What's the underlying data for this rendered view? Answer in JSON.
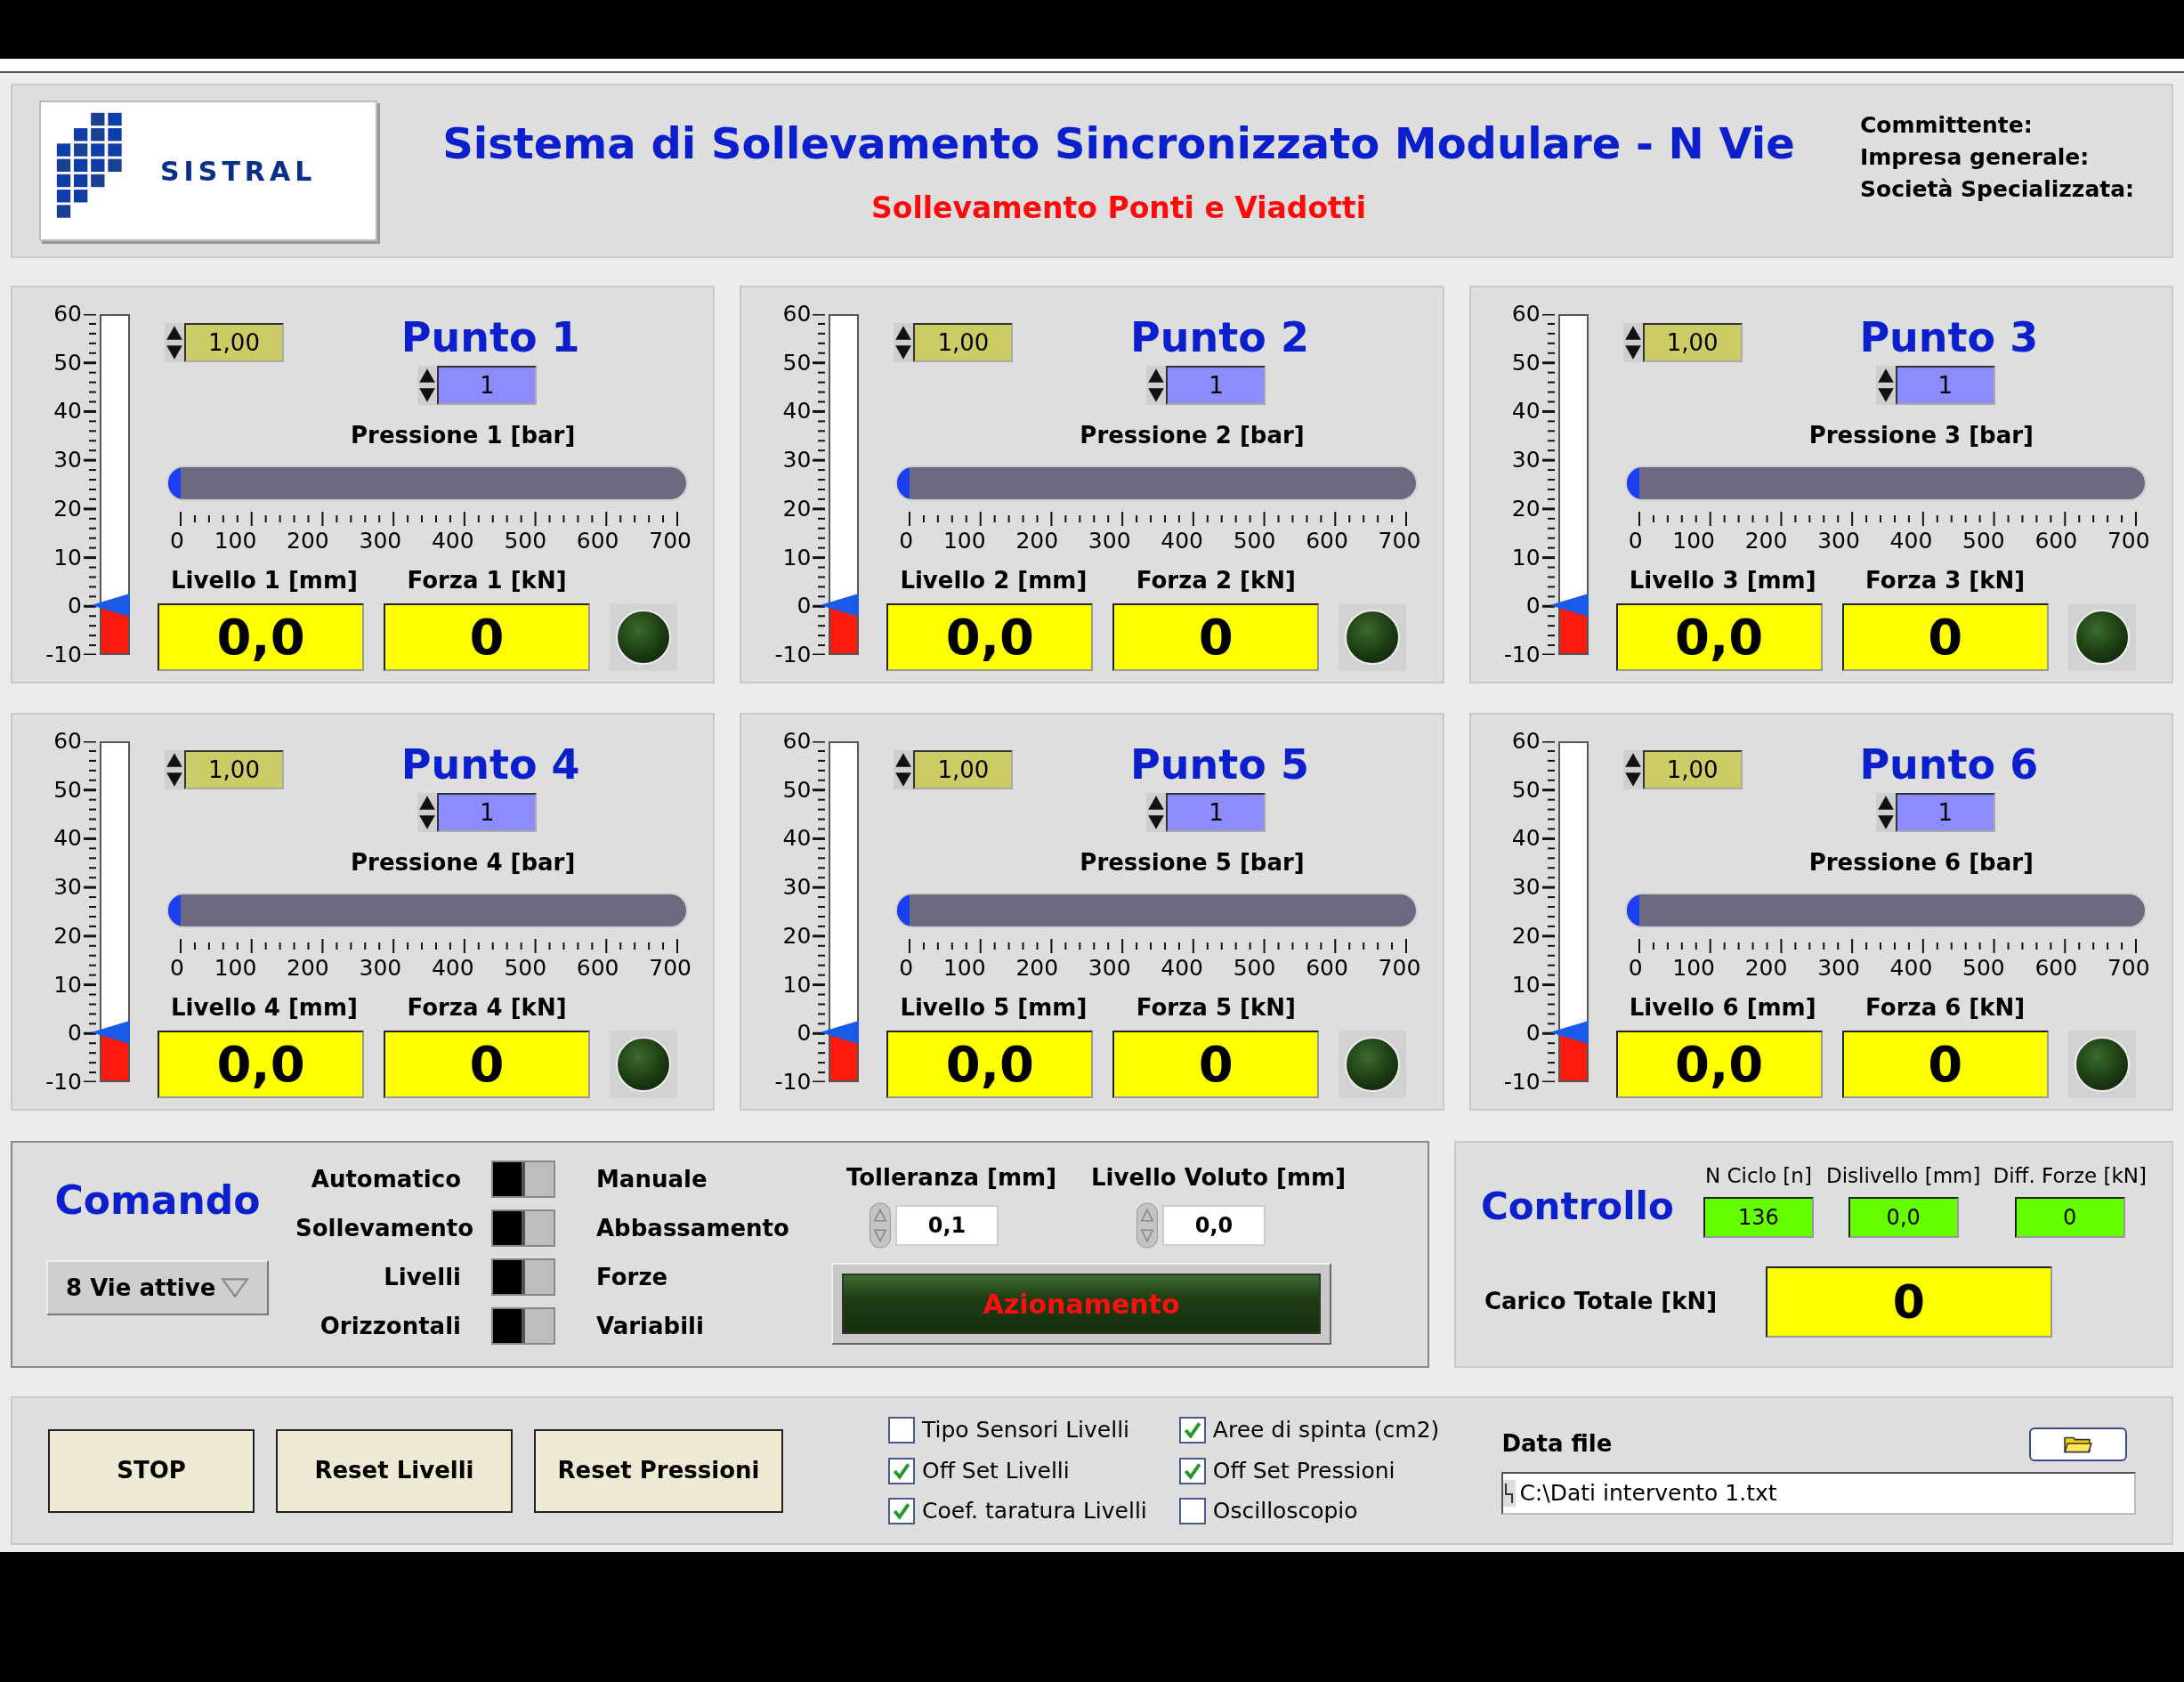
{
  "header": {
    "logo_text": "SISTRAL",
    "title": "Sistema di Sollevamento Sincronizzato Modulare - N Vie",
    "subtitle": "Sollevamento Ponti e Viadotti",
    "info": [
      "Committente:",
      "Impresa generale:",
      "Società Specializzata:"
    ]
  },
  "points": [
    {
      "title": "Punto 1",
      "gain": "1,00",
      "index": "1",
      "level_meter": {
        "level": 0.143,
        "scale": [
          "60",
          "50",
          "40",
          "30",
          "20",
          "10",
          "0",
          "-10"
        ]
      },
      "pressure_bar": {
        "label": "Pressione 1 [bar]",
        "level": 0,
        "scale": [
          "0",
          "100",
          "200",
          "300",
          "400",
          "500",
          "600",
          "700"
        ]
      },
      "level_label": "Livello 1 [mm]",
      "level_value": "0,0",
      "force_label": "Forza 1 [kN]",
      "force_value": "0",
      "led_on": false
    },
    {
      "title": "Punto 2",
      "gain": "1,00",
      "index": "1",
      "level_meter": {
        "level": 0.143,
        "scale": [
          "60",
          "50",
          "40",
          "30",
          "20",
          "10",
          "0",
          "-10"
        ]
      },
      "pressure_bar": {
        "label": "Pressione 2 [bar]",
        "level": 0,
        "scale": [
          "0",
          "100",
          "200",
          "300",
          "400",
          "500",
          "600",
          "700"
        ]
      },
      "level_label": "Livello 2 [mm]",
      "level_value": "0,0",
      "force_label": "Forza 2 [kN]",
      "force_value": "0",
      "led_on": false
    },
    {
      "title": "Punto 3",
      "gain": "1,00",
      "index": "1",
      "level_meter": {
        "level": 0.143,
        "scale": [
          "60",
          "50",
          "40",
          "30",
          "20",
          "10",
          "0",
          "-10"
        ]
      },
      "pressure_bar": {
        "label": "Pressione 3 [bar]",
        "level": 0,
        "scale": [
          "0",
          "100",
          "200",
          "300",
          "400",
          "500",
          "600",
          "700"
        ]
      },
      "level_label": "Livello 3 [mm]",
      "level_value": "0,0",
      "force_label": "Forza 3 [kN]",
      "force_value": "0",
      "led_on": false
    },
    {
      "title": "Punto 4",
      "gain": "1,00",
      "index": "1",
      "level_meter": {
        "level": 0.143,
        "scale": [
          "60",
          "50",
          "40",
          "30",
          "20",
          "10",
          "0",
          "-10"
        ]
      },
      "pressure_bar": {
        "label": "Pressione 4 [bar]",
        "level": 0,
        "scale": [
          "0",
          "100",
          "200",
          "300",
          "400",
          "500",
          "600",
          "700"
        ]
      },
      "level_label": "Livello 4 [mm]",
      "level_value": "0,0",
      "force_label": "Forza 4 [kN]",
      "force_value": "0",
      "led_on": false
    },
    {
      "title": "Punto 5",
      "gain": "1,00",
      "index": "1",
      "level_meter": {
        "level": 0.143,
        "scale": [
          "60",
          "50",
          "40",
          "30",
          "20",
          "10",
          "0",
          "-10"
        ]
      },
      "pressure_bar": {
        "label": "Pressione 5 [bar]",
        "level": 0,
        "scale": [
          "0",
          "100",
          "200",
          "300",
          "400",
          "500",
          "600",
          "700"
        ]
      },
      "level_label": "Livello 5 [mm]",
      "level_value": "0,0",
      "force_label": "Forza 5 [kN]",
      "force_value": "0",
      "led_on": false
    },
    {
      "title": "Punto 6",
      "gain": "1,00",
      "index": "1",
      "level_meter": {
        "level": 0.143,
        "scale": [
          "60",
          "50",
          "40",
          "30",
          "20",
          "10",
          "0",
          "-10"
        ]
      },
      "pressure_bar": {
        "label": "Pressione 6 [bar]",
        "level": 0,
        "scale": [
          "0",
          "100",
          "200",
          "300",
          "400",
          "500",
          "600",
          "700"
        ]
      },
      "level_label": "Livello 6 [mm]",
      "level_value": "0,0",
      "force_label": "Forza 6 [kN]",
      "force_value": "0",
      "led_on": false
    }
  ],
  "comando": {
    "title": "Comando",
    "mode_dropdown": "8 Vie attive",
    "switches": [
      {
        "left": "Automatico",
        "right": "Manuale",
        "toggled": false
      },
      {
        "left": "Sollevamento",
        "right": "Abbassamento",
        "toggled": false
      },
      {
        "left": "Livelli",
        "right": "Forze",
        "toggled": false
      },
      {
        "left": "Orizzontali",
        "right": "Variabili",
        "toggled": false
      }
    ],
    "setpoints": [
      {
        "label": "Tolleranza [mm]",
        "value": "0,1"
      },
      {
        "label": "Livello Voluto [mm]",
        "value": "0,0"
      }
    ],
    "action_button": {
      "label": "Azionamento",
      "on": false
    }
  },
  "controllo": {
    "title": "Controllo",
    "indicators": [
      {
        "label": "N Ciclo [n]",
        "value": "136"
      },
      {
        "label": "Dislivello [mm]",
        "value": "0,0"
      },
      {
        "label": "Diff. Forze [kN]",
        "value": "0"
      }
    ],
    "total": {
      "label": "Carico Totale [kN]",
      "value": "0"
    }
  },
  "bottom": {
    "buttons": [
      "STOP",
      "Reset Livelli",
      "Reset Pressioni"
    ],
    "checkboxes": [
      {
        "label": "Tipo Sensori Livelli",
        "checked": false
      },
      {
        "label": "Off Set Livelli",
        "checked": true
      },
      {
        "label": "Coef. taratura Livelli",
        "checked": true
      },
      {
        "label": "Aree di spinta (cm2)",
        "checked": true
      },
      {
        "label": "Off Set Pressioni",
        "checked": true
      },
      {
        "label": "Oscilloscopio",
        "checked": false
      }
    ],
    "data_file": {
      "label": "Data file",
      "value": "C:\\Dati intervento 1.txt"
    }
  }
}
